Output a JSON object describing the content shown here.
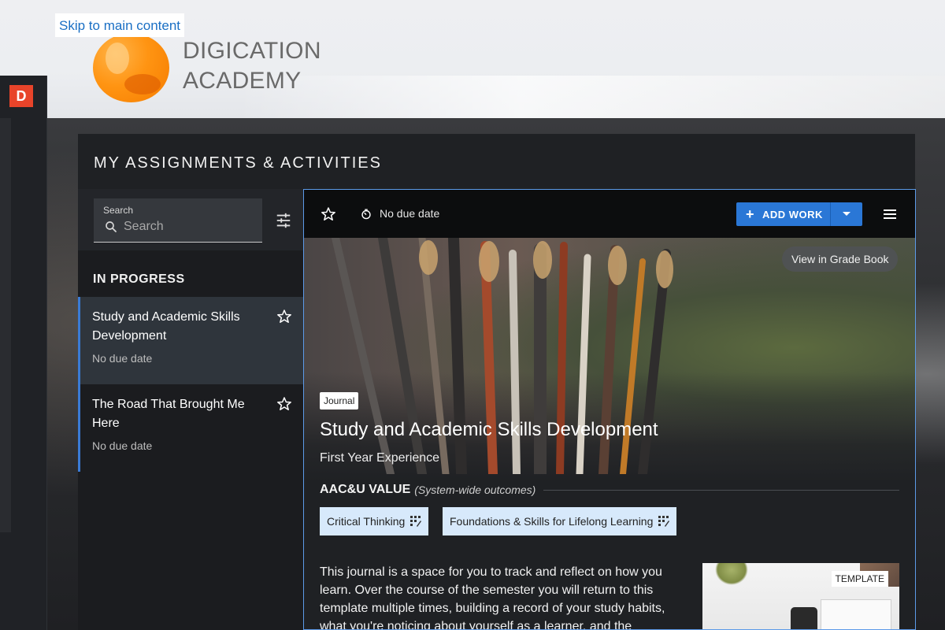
{
  "skip_link": "Skip to main content",
  "brand": {
    "line1": "DIGICATION",
    "line2": "ACADEMY",
    "rail_badge": "D"
  },
  "card": {
    "title": "MY ASSIGNMENTS & ACTIVITIES",
    "search": {
      "label": "Search",
      "placeholder": "Search"
    },
    "section_heading": "IN PROGRESS",
    "items": [
      {
        "title": "Study and Academic Skills Development",
        "due": "No due date",
        "active": true
      },
      {
        "title": "The Road That Brought Me Here",
        "due": "No due date",
        "active": false
      }
    ]
  },
  "detail": {
    "toolbar": {
      "due": "No due date",
      "add_work": "ADD WORK"
    },
    "gradebook_button": "View in Grade Book",
    "tag": "Journal",
    "title": "Study and Academic Skills Development",
    "subtitle": "First Year Experience",
    "outcomes": {
      "heading": "AAC&U VALUE",
      "note": "(System-wide outcomes)",
      "chips": [
        "Critical Thinking",
        "Foundations & Skills for Lifelong Learning"
      ]
    },
    "body": "This journal is a space for you to track and reflect on how you learn. Over the course of the semester you will return to this template multiple times, building a record of your study habits, what you're noticing about yourself as a learner, and the",
    "thumbnail_tag": "TEMPLATE"
  },
  "colors": {
    "accent": "#2a77d6",
    "brand_orange": "#ff9412",
    "chip_bg": "#d7e9fb",
    "rail_badge": "#e8442a"
  }
}
